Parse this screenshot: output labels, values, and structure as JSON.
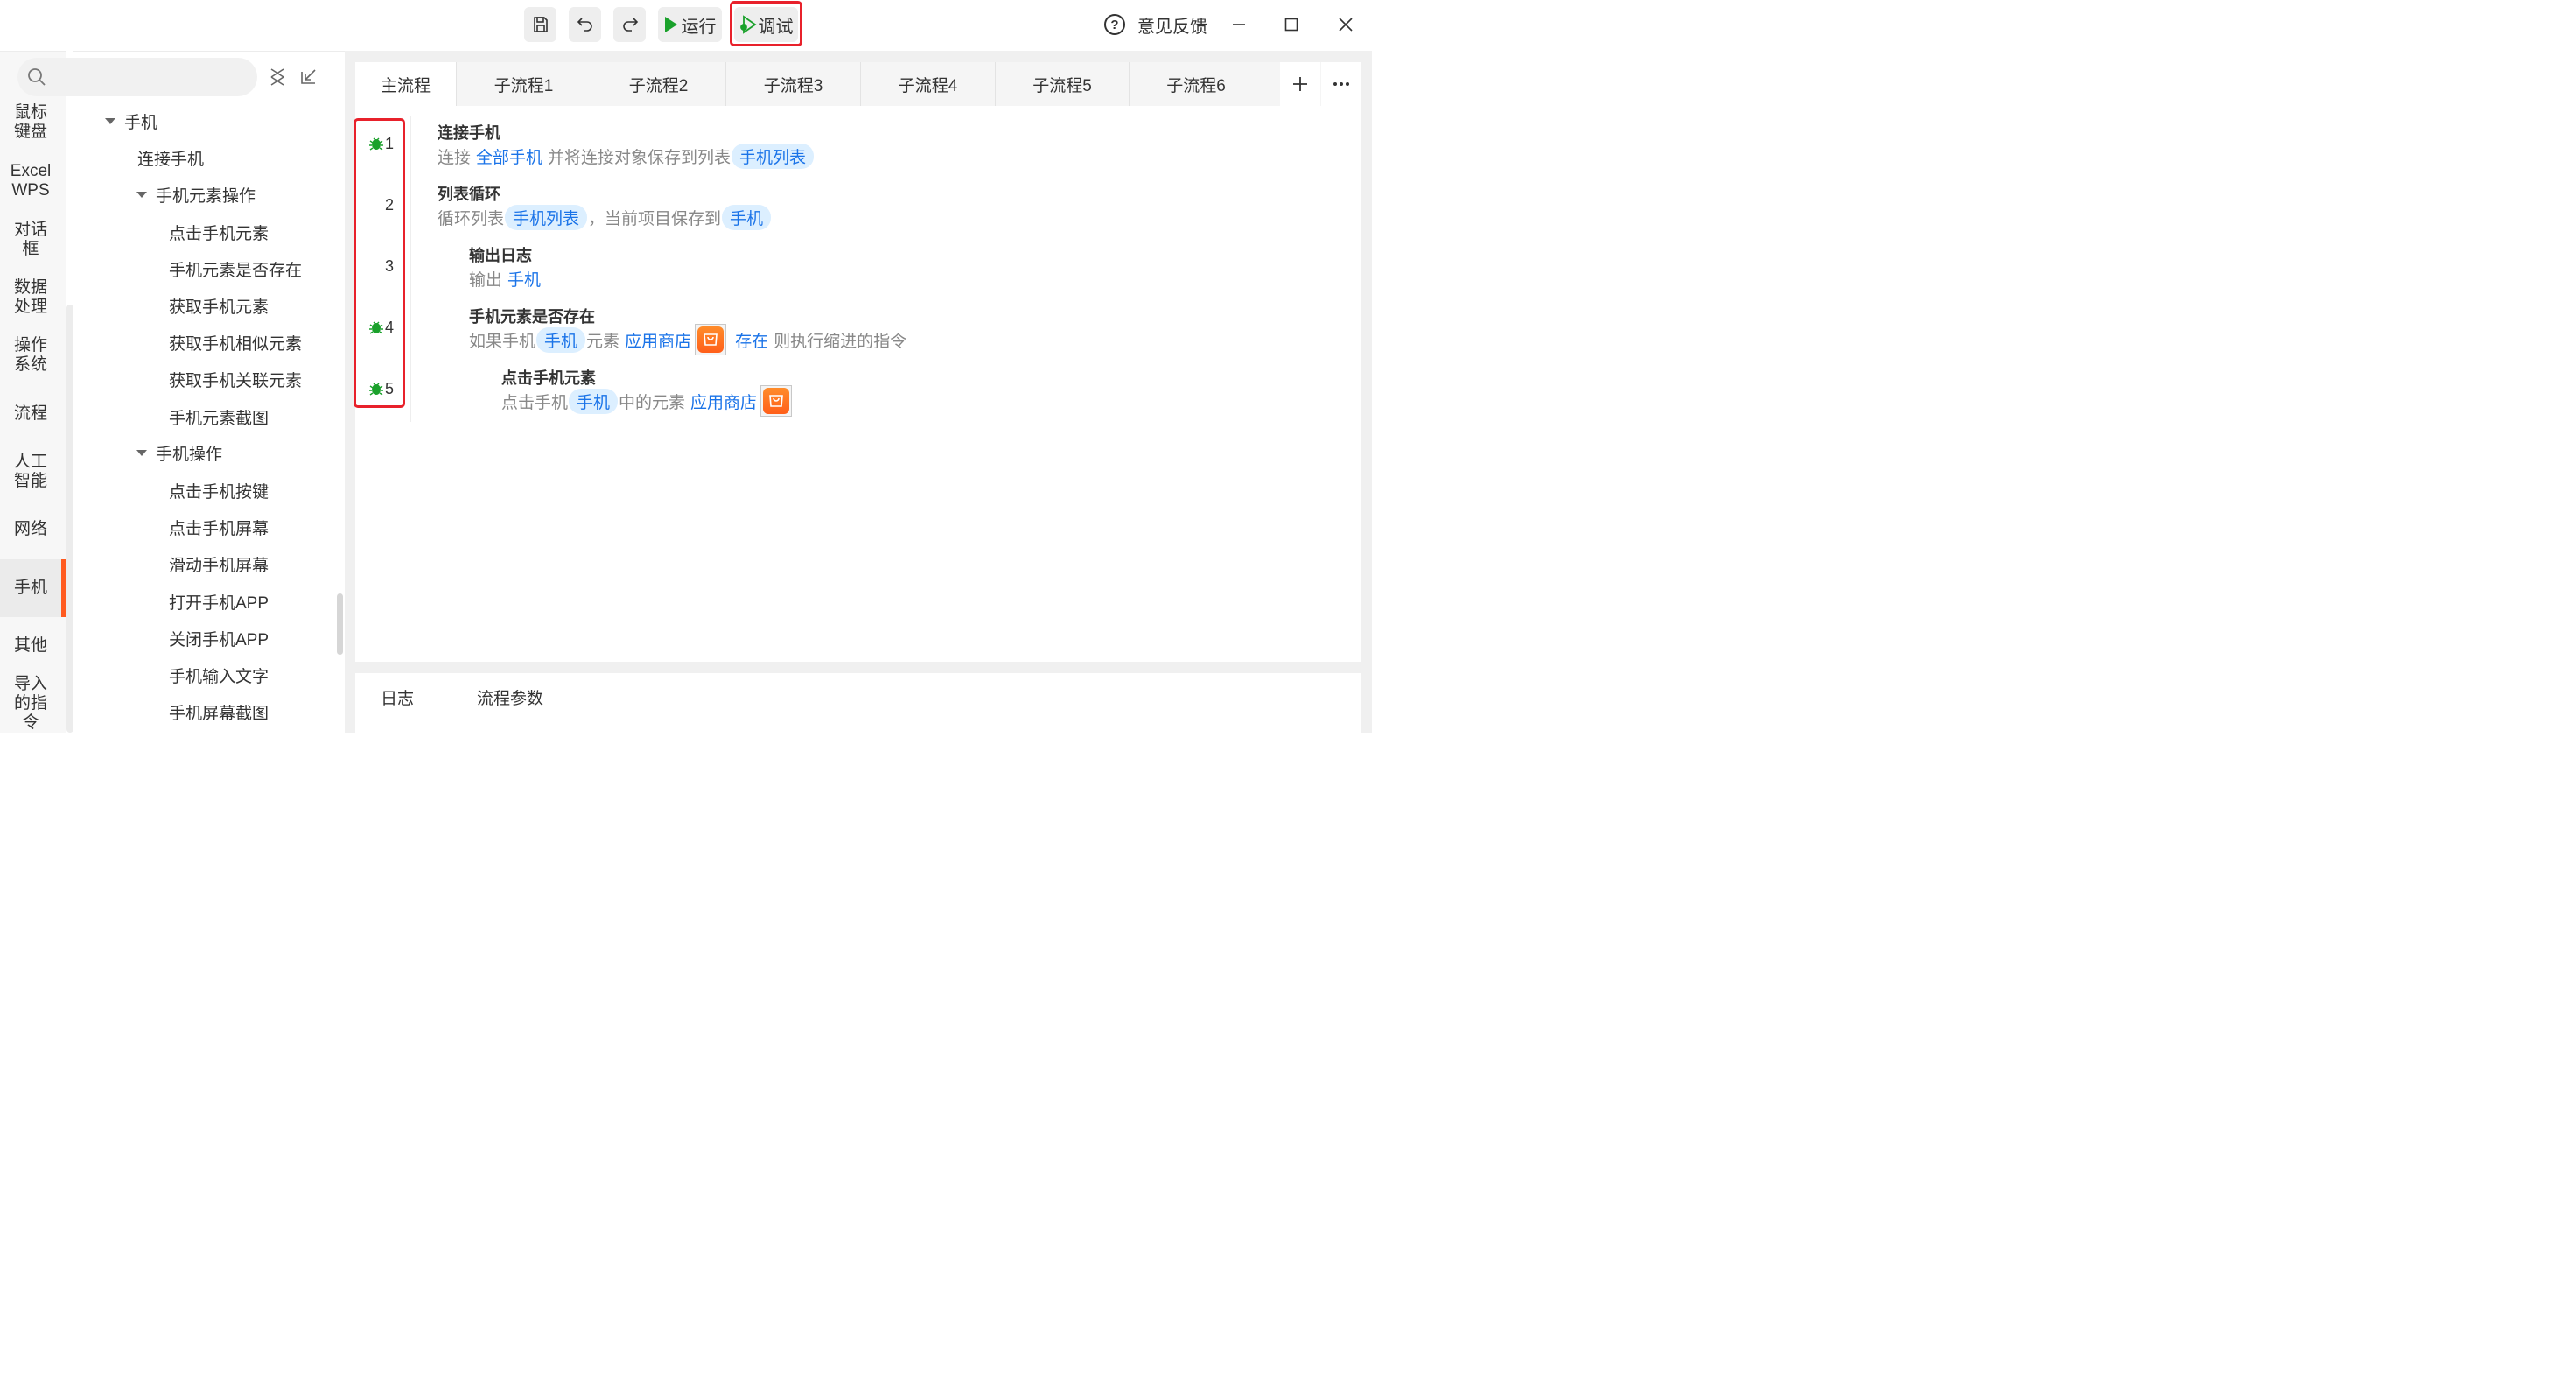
{
  "toolbar": {
    "run_label": "运行",
    "debug_label": "调试",
    "feedback_label": "意见反馈"
  },
  "rail": {
    "items": [
      {
        "label": "鼠标\n键盘"
      },
      {
        "label": "Excel\nWPS"
      },
      {
        "label": "对话\n框"
      },
      {
        "label": "数据\n处理"
      },
      {
        "label": "操作\n系统"
      },
      {
        "label": "流程"
      },
      {
        "label": "人工\n智能"
      },
      {
        "label": "网络"
      },
      {
        "label": "手机"
      },
      {
        "label": "其他"
      },
      {
        "label": "导入\n的指\n令"
      }
    ],
    "active": "手机"
  },
  "tree": {
    "search": {
      "value": "",
      "placeholder": ""
    },
    "root": "手机",
    "connect": "连接手机",
    "group1": "手机元素操作",
    "group1_items": [
      "点击手机元素",
      "手机元素是否存在",
      "获取手机元素",
      "获取手机相似元素",
      "获取手机关联元素",
      "手机元素截图"
    ],
    "group2": "手机操作",
    "group2_items": [
      "点击手机按键",
      "点击手机屏幕",
      "滑动手机屏幕",
      "打开手机APP",
      "关闭手机APP",
      "手机输入文字",
      "手机屏幕截图"
    ]
  },
  "tabs": [
    "主流程",
    "子流程1",
    "子流程2",
    "子流程3",
    "子流程4",
    "子流程5",
    "子流程6"
  ],
  "active_tab": "主流程",
  "steps": [
    {
      "no": "1",
      "breakpoint": true,
      "title": "连接手机",
      "d1": "连接",
      "d2": "全部手机",
      "d3": "并将连接对象保存到列表",
      "d4": "手机列表"
    },
    {
      "no": "2",
      "breakpoint": false,
      "title": "列表循环",
      "d1": "循环列表",
      "d2": "手机列表",
      "d3": "，当前项目保存到",
      "d4": "手机"
    },
    {
      "no": "3",
      "breakpoint": false,
      "title": "输出日志",
      "d1": "输出",
      "d2": "手机"
    },
    {
      "no": "4",
      "breakpoint": true,
      "title": "手机元素是否存在",
      "d1": "如果手机",
      "d2": "手机",
      "d3": "元素",
      "d4": "应用商店",
      "d5": "存在",
      "d6": "则执行缩进的指令"
    },
    {
      "no": "5",
      "breakpoint": true,
      "title": "点击手机元素",
      "d1": "点击手机",
      "d2": "手机",
      "d3": "中的元素",
      "d4": "应用商店"
    }
  ],
  "bottom_tabs": [
    "日志",
    "流程参数"
  ],
  "colors": {
    "accent_red": "#e8212b",
    "active_orange": "#ff5a1f",
    "link_blue": "#1a73e8",
    "run_green": "#1aa12b",
    "bug_green": "#1aa12b",
    "app_icon": "#ff6a1f"
  },
  "icons": [
    "save-icon",
    "undo-icon",
    "redo-icon",
    "play-icon",
    "debug-icon",
    "help-icon",
    "minimize-icon",
    "maximize-icon",
    "close-icon",
    "search-icon",
    "clear-icon",
    "collapse-icon",
    "bug-icon",
    "plus-icon",
    "more-icon",
    "app-store-icon"
  ]
}
